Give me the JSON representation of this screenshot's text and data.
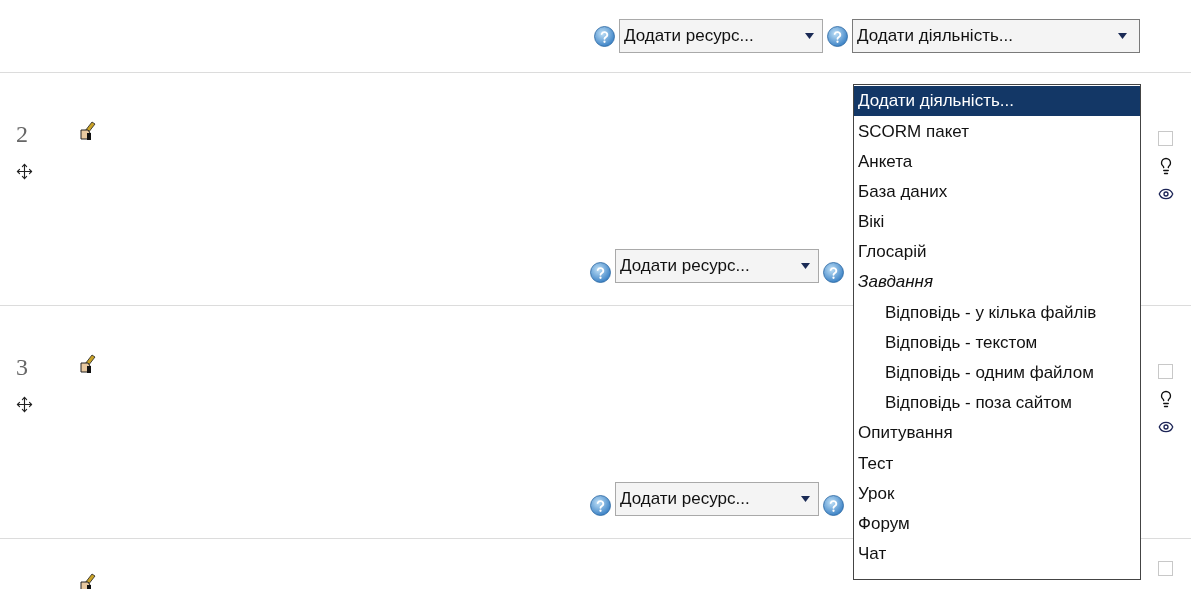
{
  "top_controls": {
    "resource_select": "Додати ресурс...",
    "activity_select": {
      "value": "Додати діяльність...",
      "expanded": true
    }
  },
  "sections": [
    {
      "number": "2",
      "checked": false,
      "resource_select": "Додати ресурс..."
    },
    {
      "number": "3",
      "checked": false,
      "resource_select": "Додати ресурс..."
    },
    {
      "checked": false
    }
  ],
  "activity_menu": [
    {
      "label": "Додати діяльність...",
      "selected": true
    },
    {
      "label": "SCORM пакет",
      "selected": false
    },
    {
      "label": "Анкета",
      "selected": false
    },
    {
      "label": "База даних",
      "selected": false
    },
    {
      "label": "Вікі",
      "selected": false
    },
    {
      "label": "Глосарій",
      "selected": false
    },
    {
      "label": "Завдання",
      "kind": "group",
      "children": [
        {
          "label": "Відповідь - у кілька файлів",
          "selected": false
        },
        {
          "label": "Відповідь - текстом",
          "selected": false
        },
        {
          "label": "Відповідь - одним файлом",
          "selected": false
        },
        {
          "label": "Відповідь - поза сайтом",
          "selected": false
        }
      ]
    },
    {
      "label": "Опитування",
      "selected": false
    },
    {
      "label": "Тест",
      "selected": false
    },
    {
      "label": "Урок",
      "selected": false
    },
    {
      "label": "Форум",
      "selected": false
    },
    {
      "label": "Чат",
      "selected": false
    }
  ]
}
